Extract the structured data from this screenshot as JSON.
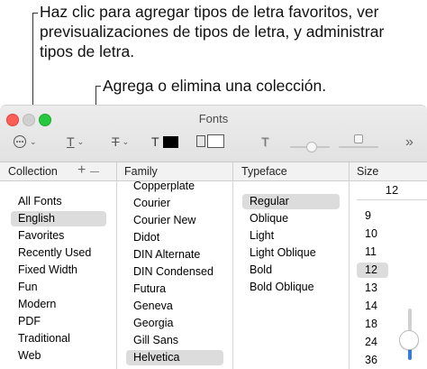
{
  "callouts": {
    "favorites": "Haz clic para agregar tipos de letra favoritos, ver previsualizaciones de tipos de letra, y administrar tipos de letra.",
    "collection": "Agrega o elimina una colección."
  },
  "window": {
    "title": "Fonts"
  },
  "toolbar": {
    "action_icon": "ellipsis-circle-icon",
    "text_icon": "T",
    "strike_icon": "T",
    "color_icon": "T",
    "shadow_icon": "T",
    "more_icon": "»"
  },
  "columns": {
    "collection": "Collection",
    "add_symbol": "+",
    "family": "Family",
    "typeface": "Typeface",
    "size": "Size"
  },
  "collections": {
    "items": [
      "All Fonts",
      "English",
      "Favorites",
      "Recently Used",
      "Fixed Width",
      "Fun",
      "Modern",
      "PDF",
      "Traditional",
      "Web"
    ],
    "selected_index": 1
  },
  "families": {
    "items": [
      "Copperplate",
      "Courier",
      "Courier New",
      "Didot",
      "DIN Alternate",
      "DIN Condensed",
      "Futura",
      "Geneva",
      "Georgia",
      "Gill Sans",
      "Helvetica"
    ],
    "selected_index": 10
  },
  "typefaces": {
    "items": [
      "Regular",
      "Oblique",
      "Light",
      "Light Oblique",
      "Bold",
      "Bold Oblique"
    ],
    "selected_index": 0
  },
  "size": {
    "current": "12",
    "items": [
      "9",
      "10",
      "11",
      "12",
      "13",
      "14",
      "18",
      "24",
      "36"
    ],
    "selected_index": 3,
    "slider_level_pct": 40
  },
  "colors": {
    "text_swatch": "#000000",
    "doc_swatch": "#ffffff",
    "accent": "#2d7bf6"
  }
}
